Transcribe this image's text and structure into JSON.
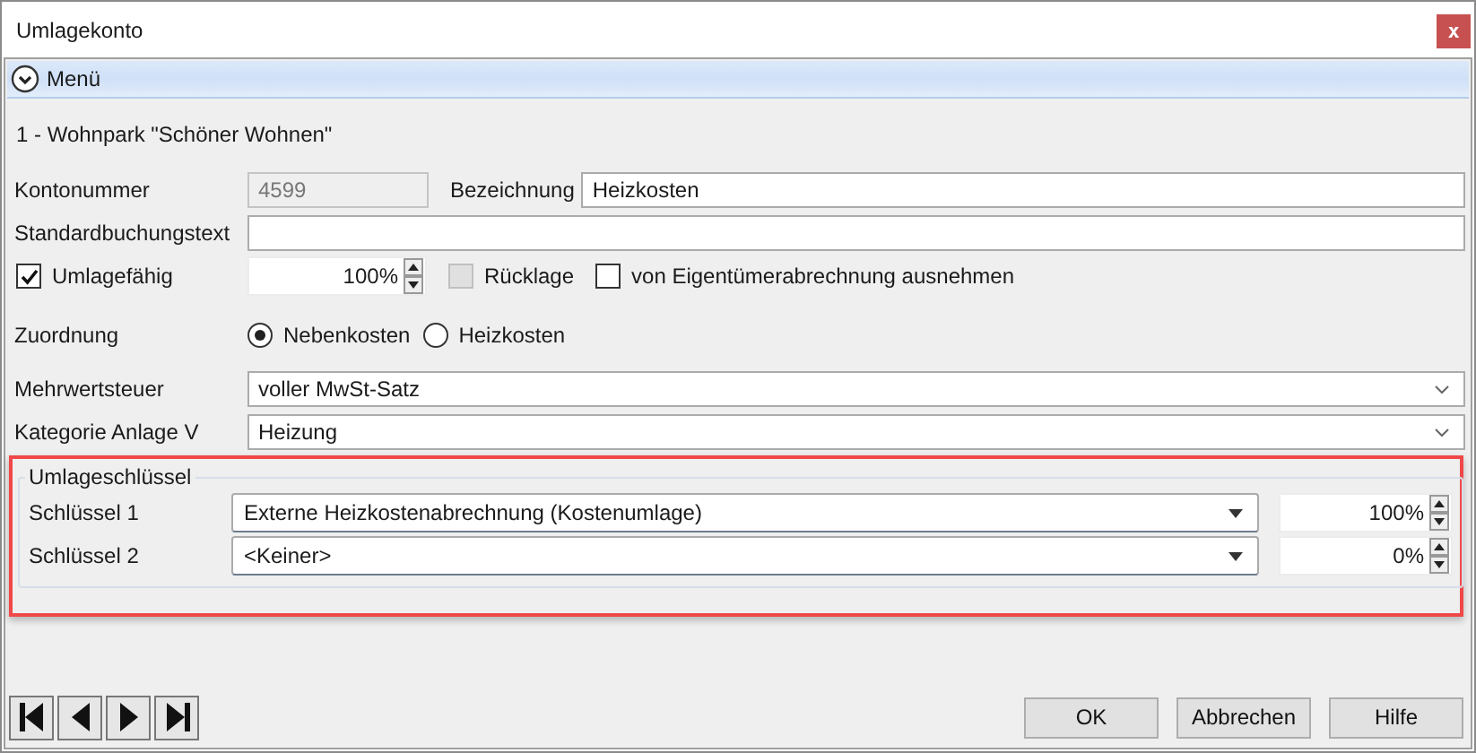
{
  "window": {
    "title": "Umlagekonto",
    "close": "x"
  },
  "menu": {
    "label": "Menü"
  },
  "property": "1 - Wohnpark \"Schöner Wohnen\"",
  "kontonummer": {
    "label": "Kontonummer",
    "value": "4599",
    "disabled": true
  },
  "bezeichnung": {
    "label": "Bezeichnung",
    "value": "Heizkosten"
  },
  "buchungstext": {
    "label": "Standardbuchungstext"
  },
  "umlagefaehig": {
    "label": "Umlagefähig",
    "checked": true,
    "percent": "100%"
  },
  "ruecklage": {
    "label": "Rücklage",
    "checked": false,
    "disabled": true
  },
  "ausnehmen": {
    "label": "von Eigentümerabrechnung ausnehmen",
    "checked": false
  },
  "zuordnung": {
    "label": "Zuordnung",
    "options": [
      {
        "label": "Nebenkosten",
        "selected": true
      },
      {
        "label": "Heizkosten",
        "selected": false
      }
    ]
  },
  "selects": [
    {
      "label": "Mehrwertsteuer",
      "value": "voller MwSt-Satz"
    },
    {
      "label": "Kategorie Anlage V",
      "value": "Heizung"
    }
  ],
  "umlageschluessel": {
    "title": "Umlageschlüssel",
    "highlighted": true,
    "rows": [
      {
        "label": "Schlüssel 1",
        "value": "Externe Heizkostenabrechnung (Kostenumlage)",
        "percent": "100%"
      },
      {
        "label": "Schlüssel 2",
        "value": "<Keiner>",
        "percent": "0%"
      }
    ]
  },
  "buttons": [
    "OK",
    "Abbrechen",
    "Hilfe"
  ]
}
